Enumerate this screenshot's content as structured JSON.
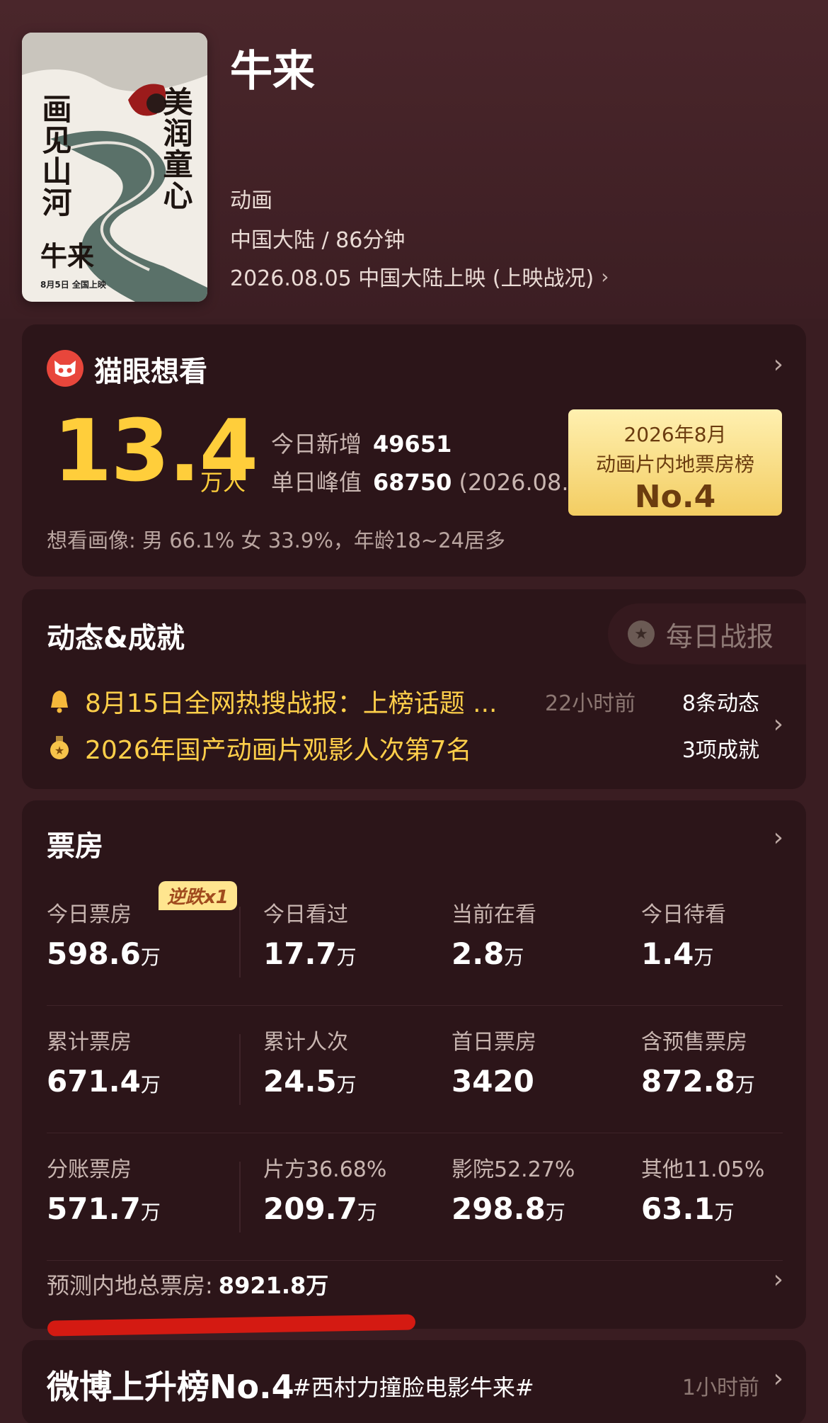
{
  "movie": {
    "title": "牛来",
    "genre": "动画",
    "region_duration": "中国大陆 / 86分钟",
    "release": "2026.08.05 中国大陆上映 (上映战况)",
    "poster": {
      "left_text": "画见山河",
      "right_text": "美润童心",
      "name": "牛来",
      "date": "8月5日  全国上映"
    }
  },
  "maoyan": {
    "title": "猫眼想看",
    "big_number": "13.4",
    "big_unit": "万人",
    "today_new_label": "今日新增",
    "today_new_value": "49651",
    "peak_label": "单日峰值",
    "peak_value": "68750",
    "peak_extra": "(2026.08...",
    "rank_line1": "2026年8月",
    "rank_line2": "动画片内地票房榜",
    "rank_line3": "No.4",
    "portrait": "想看画像: 男 66.1%  女 33.9%，年龄18~24居多"
  },
  "dynamics": {
    "title": "动态&成就",
    "daily_report": "每日战报",
    "news1": "8月15日全网热搜战报：上榜话题 ...",
    "news1_time": "22小时前",
    "news1_count": "8条动态",
    "news2": "2026年国产动画片观影人次第7名",
    "news2_count": "3项成就"
  },
  "boxoffice": {
    "title": "票房",
    "tag": "逆跌x1",
    "rows": [
      [
        {
          "label": "今日票房",
          "value": "598.6",
          "unit": "万"
        },
        {
          "label": "今日看过",
          "value": "17.7",
          "unit": "万"
        },
        {
          "label": "当前在看",
          "value": "2.8",
          "unit": "万"
        },
        {
          "label": "今日待看",
          "value": "1.4",
          "unit": "万"
        }
      ],
      [
        {
          "label": "累计票房",
          "value": "671.4",
          "unit": "万"
        },
        {
          "label": "累计人次",
          "value": "24.5",
          "unit": "万"
        },
        {
          "label": "首日票房",
          "value": "3420",
          "unit": ""
        },
        {
          "label": "含预售票房",
          "value": "872.8",
          "unit": "万"
        }
      ],
      [
        {
          "label": "分账票房",
          "value": "571.7",
          "unit": "万"
        },
        {
          "label": "片方36.68%",
          "value": "209.7",
          "unit": "万"
        },
        {
          "label": "影院52.27%",
          "value": "298.8",
          "unit": "万"
        },
        {
          "label": "其他11.05%",
          "value": "63.1",
          "unit": "万"
        }
      ]
    ],
    "forecast_label": "预测内地总票房:",
    "forecast_value": "8921.8万"
  },
  "weibo": {
    "title": "微博上升榜No.4",
    "tag": "#西村力撞脸电影牛来#",
    "time": "1小时前"
  },
  "colors": {
    "background": "#3a1d22",
    "card": "#2c1519",
    "accent_yellow": "#ffce3b",
    "highlight_red": "#d41a12"
  }
}
